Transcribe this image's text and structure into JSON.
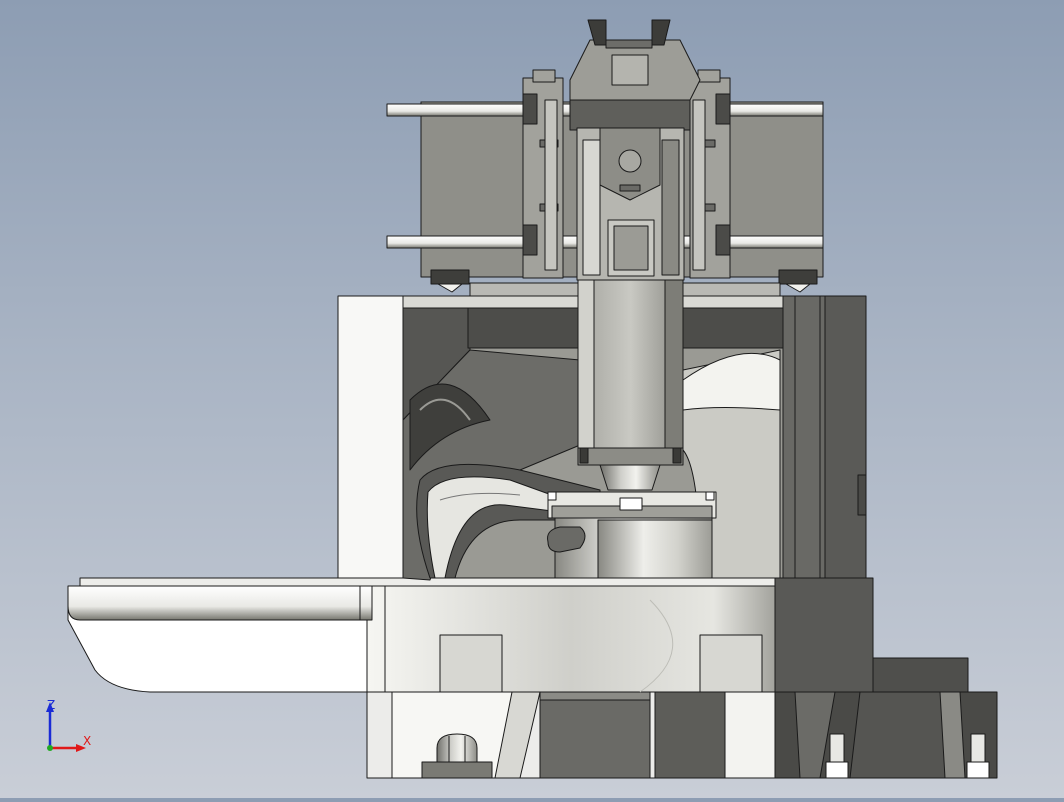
{
  "view": {
    "background_top": "#8d9db3",
    "background_bottom": "#c9ced7",
    "model_light": "#f4f4f0",
    "model_mid": "#9a9a93",
    "model_dark": "#4c4c4a",
    "edge_color": "#1a1a1a"
  },
  "triad": {
    "x_label": "X",
    "z_label": "Z",
    "x_color": "#e01818",
    "z_color": "#1a2bd6",
    "origin_color": "#22aa22"
  }
}
